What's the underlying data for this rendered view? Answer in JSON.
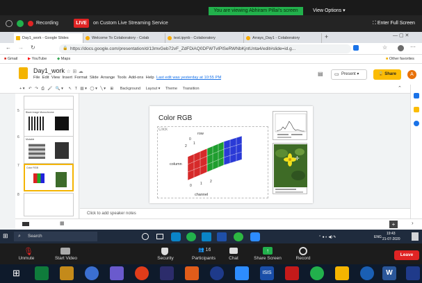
{
  "zoom": {
    "banner": "You are viewing Abhiram Pillai's screen",
    "view_options": "View Options",
    "recording": "Recording",
    "live": "LIVE",
    "live_service": "on Custom Live Streaming Service",
    "enter_full_screen": "Enter Full Screen",
    "controls": [
      "Unmute",
      "Start Video",
      "Security",
      "Participants",
      "Chat",
      "Share Screen",
      "Record"
    ],
    "participants_count": "16",
    "leave": "Leave"
  },
  "browser": {
    "tabs": [
      {
        "label": "Day1_work - Google Slides",
        "color": "#f4b400",
        "active": true
      },
      {
        "label": "Welcome To Colaboratory - Colab",
        "color": "#f9ab00",
        "active": false
      },
      {
        "label": "test.ipynb - Colaboratory",
        "color": "#f9ab00",
        "active": false
      },
      {
        "label": "Arrays_Day1 - Colaboratory",
        "color": "#f9ab00",
        "active": false
      }
    ],
    "url": "https://docs.google.com/presentation/d/13mvGeb72vF_ZdFDiAQ0DFWTvlPlSeRWNbKjntUnta4/edit#slide=id.g...",
    "bookmarks": [
      "Gmail",
      "YouTube",
      "Maps"
    ],
    "other_favorites": "Other favorites"
  },
  "slides": {
    "doc_title": "Day1_work",
    "menu": [
      "File",
      "Edit",
      "View",
      "Insert",
      "Format",
      "Slide",
      "Arrange",
      "Tools",
      "Add-ons",
      "Help"
    ],
    "last_edit": "Last edit was yesterday at 10:55 PM",
    "present": "Present",
    "share": "Share",
    "avatar": "A",
    "toolbar": [
      "Background",
      "Layout",
      "Theme",
      "Transition"
    ],
    "thumbnail_numbers": [
      "5",
      "6",
      "7"
    ],
    "thumbnail_titles": [
      "Black Image Monochrome",
      "Mutable",
      "Color RGB"
    ],
    "slide_title": "Color RGB",
    "placeholder": "Click",
    "axis_row": "row",
    "axis_column": "column",
    "axis_channel": "channel",
    "axis_ticks": [
      "0",
      "1",
      "2"
    ],
    "notes": "Click to add speaker notes"
  },
  "taskbar": {
    "search": "Search",
    "time": "19:43",
    "date": "21-07-2020",
    "lang": "ENG"
  },
  "colors": {
    "zoom_green": "#22b14c",
    "live_red": "#e02424",
    "slides_yellow": "#f4b400",
    "selection": "#f4b400"
  }
}
